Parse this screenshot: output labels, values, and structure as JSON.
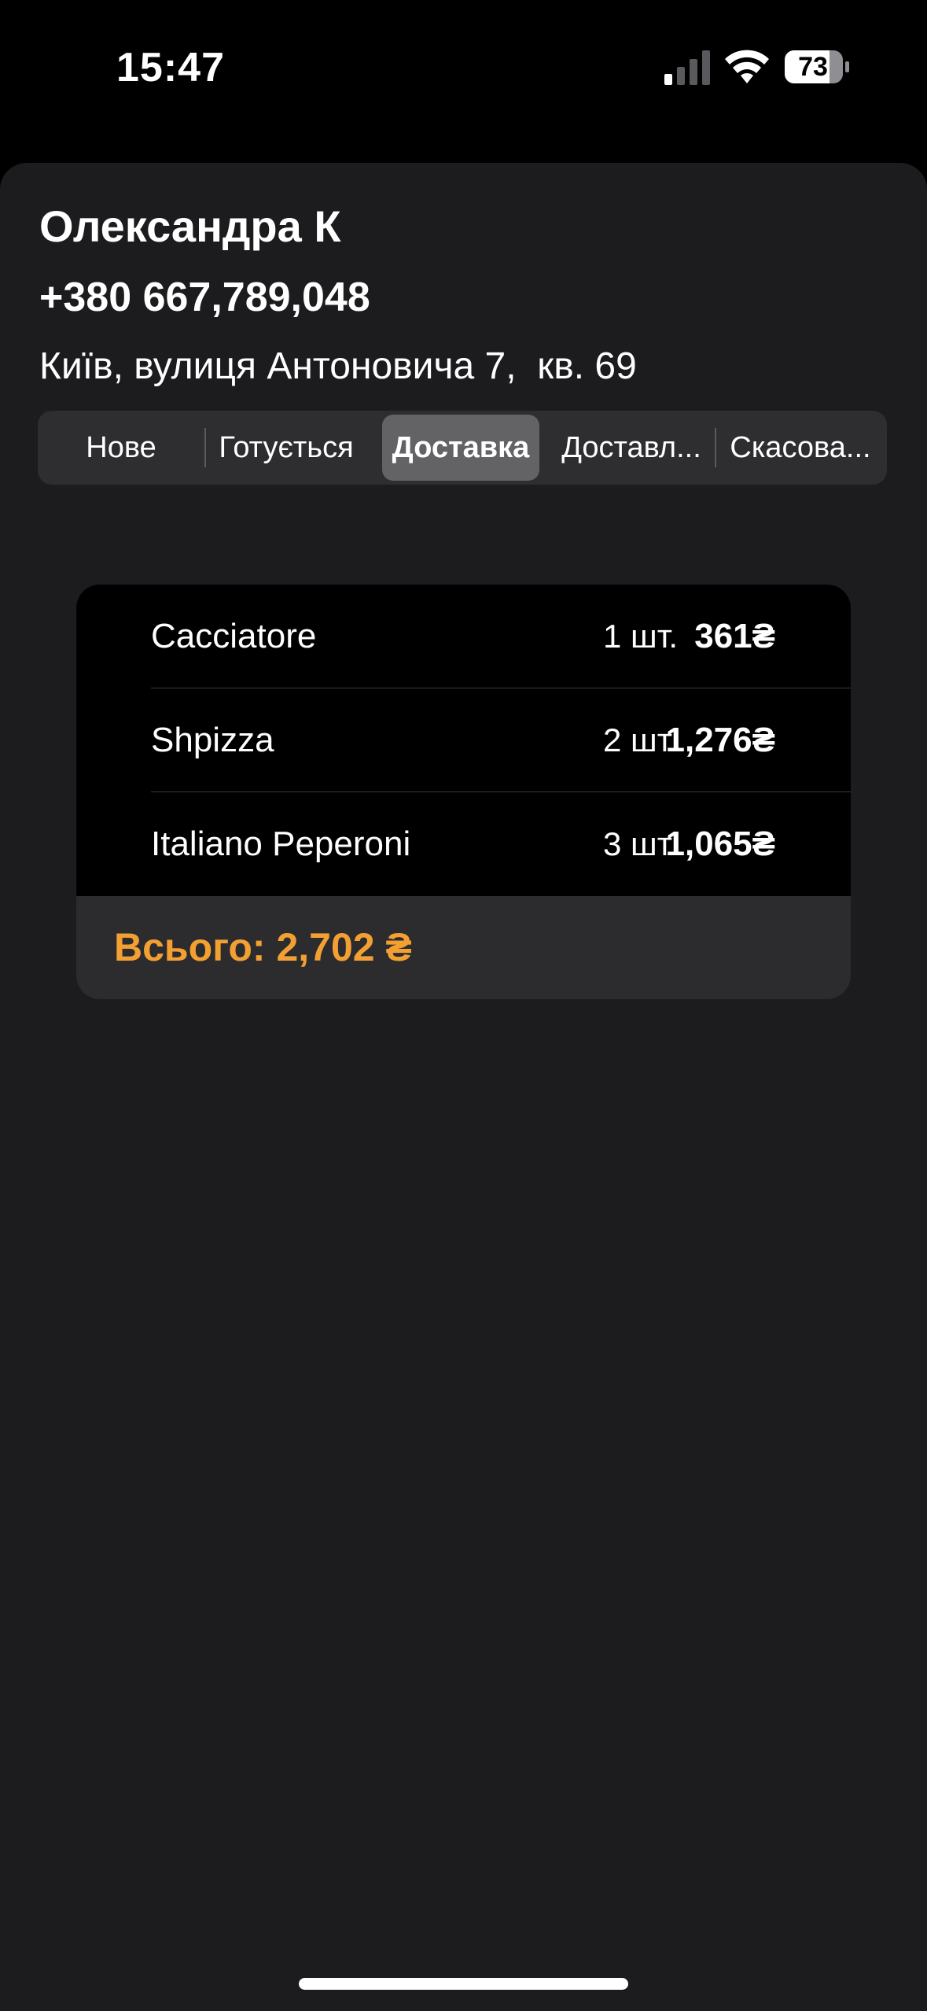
{
  "status_bar": {
    "time": "15:47",
    "battery": "73"
  },
  "customer": {
    "name": "Олександра К",
    "phone": "+380 667,789,048",
    "address": "Київ, вулиця Антоновича 7,  кв. 69"
  },
  "status_segments": {
    "items": [
      {
        "label": "Нове"
      },
      {
        "label": "Готується"
      },
      {
        "label": "Доставка"
      },
      {
        "label": "Доставл..."
      },
      {
        "label": "Скасова..."
      }
    ],
    "selected": "Доставка"
  },
  "order": {
    "items": [
      {
        "name": "Cacciatore",
        "qty": "1 шт.",
        "price": "361₴"
      },
      {
        "name": "Shpizza",
        "qty": "2 шт.",
        "price": "1,276₴"
      },
      {
        "name": "Italiano Peperoni",
        "qty": "3 шт.",
        "price": "1,065₴"
      }
    ],
    "total": "Всього: 2,702 ₴"
  },
  "colors": {
    "accent": "#f3a033",
    "sheet_background": "#1c1c1e",
    "card_background": "#000000",
    "segment_selected": "#636366"
  }
}
